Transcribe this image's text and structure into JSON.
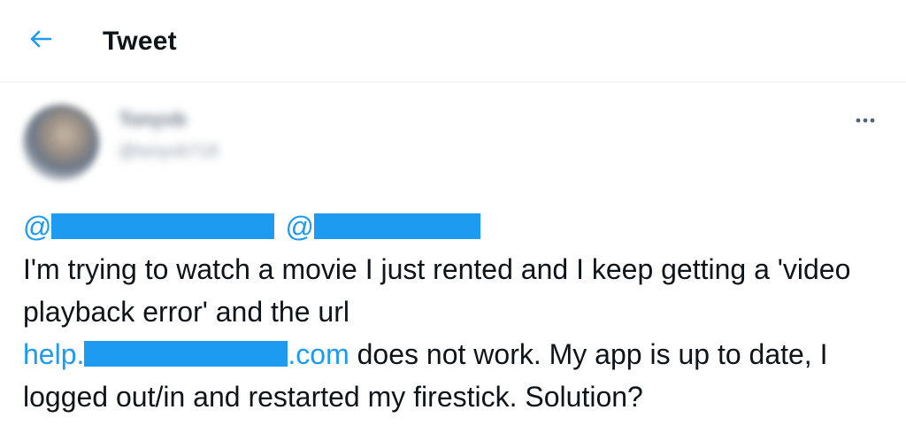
{
  "header": {
    "title": "Tweet",
    "back_icon": "arrow-left-icon"
  },
  "author": {
    "name": "Tonyvb",
    "handle": "@tonyvb718",
    "avatar_icon": "user-avatar"
  },
  "more_icon": "ellipsis-icon",
  "tweet": {
    "mention_prefix_1": "@",
    "mention_prefix_2": "@",
    "line_1": "I'm trying to watch a movie I just rented and I keep getting a 'video playback error' and the url",
    "link_prefix": "help.",
    "link_suffix": ".com",
    "line_2": " does not work. My app is up to date, I logged out/in and restarted my firestick. Solution?"
  },
  "colors": {
    "accent": "#1d9bf0",
    "text": "#0f1419",
    "divider": "#eff3f4"
  }
}
